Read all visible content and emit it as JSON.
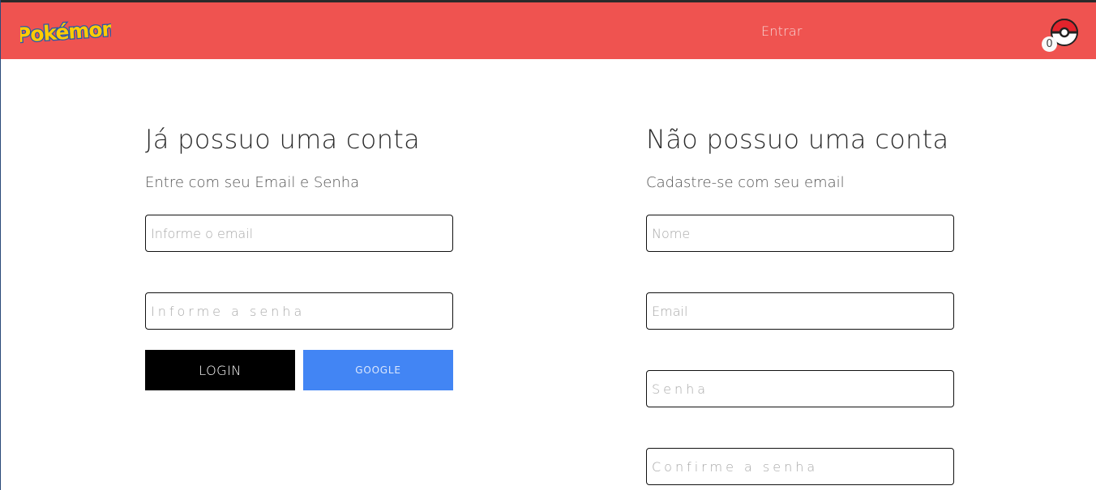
{
  "header": {
    "logo_text": "Pokémon",
    "nav_link": "Entrar",
    "cart_count": "0",
    "colors": {
      "navbar": "#ef5350",
      "logo_yellow": "#ffcb05",
      "logo_blue": "#2a5aa8"
    }
  },
  "login": {
    "title": "Já possuo uma conta",
    "subtitle": "Entre com seu Email e Senha",
    "email_placeholder": "Informe o email",
    "password_placeholder": "Informe a senha",
    "login_button": "LOGIN",
    "google_button": "GOOGLE",
    "colors": {
      "login_button": "#000000",
      "google_button": "#4285f4"
    }
  },
  "register": {
    "title": "Não possuo uma conta",
    "subtitle": "Cadastre-se com seu email",
    "name_placeholder": "Nome",
    "email_placeholder": "Email",
    "password_placeholder": "Senha",
    "confirm_placeholder": "Confirme a senha"
  }
}
